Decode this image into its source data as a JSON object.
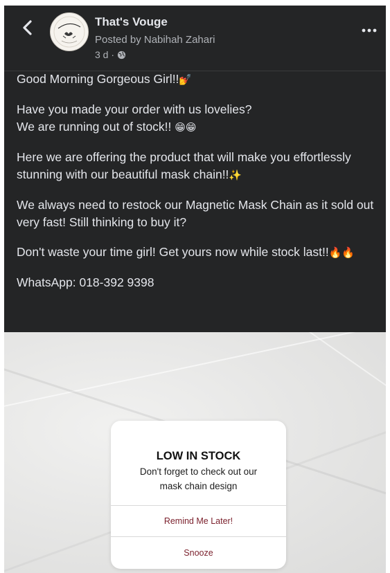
{
  "header": {
    "page_name": "That's Vouge",
    "posted_by": "Posted by Nabihah Zahari",
    "time": "3 d ·",
    "back_icon": "chevron-left-icon",
    "more_icon": "more-horizontal-icon",
    "privacy_icon": "globe-icon",
    "avatar_text": "That's Vouge"
  },
  "post": {
    "p1": "Good Morning Gorgeous Girl!!",
    "p1_emoji": "💅",
    "p2_line1": "Have you made your order with us lovelies?",
    "p2_line2": "We are running out of stock!!",
    "p2_emoji": "😁😁",
    "p3": "Here we are offering the product that will make you effortlessly stunning with our beautiful mask chain!!",
    "p3_emoji": "✨",
    "p4": "We always need to restock our Magnetic Mask Chain as it sold out very fast! Still thinking to buy it?",
    "p5": "Don't waste your time girl! Get yours now while stock last!!",
    "p5_emoji": "🔥🔥",
    "p6": "WhatsApp: 018-392 9398"
  },
  "image_card": {
    "title": "LOW IN STOCK",
    "message": "Don't forget to check out our mask chain design",
    "button1": "Remind Me Later!",
    "button2": "Snooze",
    "accent_color": "#7a1f2b"
  },
  "colors": {
    "background": "#242526",
    "text_primary": "#e4e6eb",
    "text_secondary": "#b0b3b8"
  }
}
